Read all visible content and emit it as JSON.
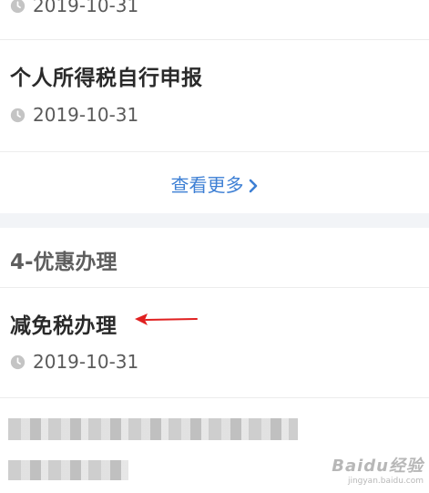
{
  "items": [
    {
      "date": "2019-10-31"
    },
    {
      "title": "个人所得税自行申报",
      "date": "2019-10-31"
    }
  ],
  "more_link": {
    "label": "查看更多"
  },
  "section": {
    "heading": "4-优惠办理",
    "item": {
      "title": "减免税办理",
      "date": "2019-10-31"
    }
  },
  "colors": {
    "accent": "#3d7fd4",
    "arrow": "#e02020",
    "gap": "#f2f4f7"
  },
  "icons": {
    "clock": "clock-icon",
    "chevron": "chevron-right-icon"
  },
  "watermark": {
    "brand": "Baidu经验",
    "url": "jingyan.baidu.com"
  }
}
